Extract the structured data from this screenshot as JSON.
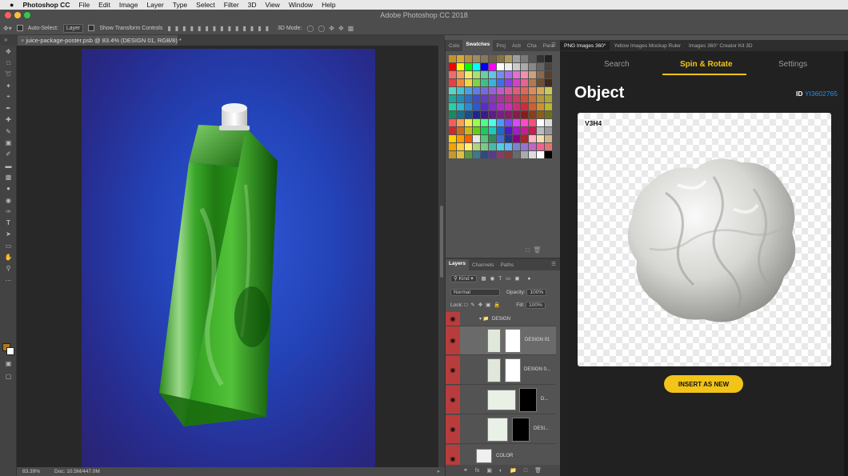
{
  "mac_menu": {
    "app_name": "Photoshop CC",
    "items": [
      "File",
      "Edit",
      "Image",
      "Layer",
      "Type",
      "Select",
      "Filter",
      "3D",
      "View",
      "Window",
      "Help"
    ]
  },
  "window": {
    "title": "Adobe Photoshop CC 2018"
  },
  "options_bar": {
    "auto_select_label": "Auto-Select:",
    "auto_select_value": "Layer",
    "show_transform_label": "Show Transform Controls",
    "mode_3d_label": "3D Mode:"
  },
  "document": {
    "tab_label": "juice-package-poster.psb @ 83.4% (DESIGN 01, RGB/8) *"
  },
  "status_bar": {
    "zoom": "83.39%",
    "doc_size": "Doc: 10.5M/447.0M"
  },
  "tools": {
    "fg_color": "#b07a12",
    "bg_color": "#ffffff"
  },
  "swatches_panel": {
    "tabs": [
      "Colo",
      "Swatches",
      "Proj",
      "Acti",
      "Cha",
      "Para"
    ],
    "active_tab": "Swatches",
    "swatches": [
      "#c8902a",
      "#d8a838",
      "#b88f3c",
      "#9a8d66",
      "#86775e",
      "#6b6049",
      "#8a7340",
      "#ad9a5a",
      "#9e9e9e",
      "#7a7a7a",
      "#555",
      "#333",
      "#222",
      "#ff0000",
      "#ffff00",
      "#00ff00",
      "#00ffff",
      "#0000ff",
      "#ff00ff",
      "#ffffff",
      "#eeeeee",
      "#cccccc",
      "#aaaaaa",
      "#888888",
      "#666666",
      "#444444",
      "#f26b6b",
      "#f5a25f",
      "#f8e66b",
      "#a9e26a",
      "#66d19e",
      "#5ec6e8",
      "#6d8ef2",
      "#a46df2",
      "#e46ddb",
      "#f28fb0",
      "#cf9f7a",
      "#8a6a4e",
      "#5a3f2a",
      "#e83f3f",
      "#ef8a3a",
      "#f0d63d",
      "#7fd34a",
      "#3fbf86",
      "#3ab1de",
      "#3f6fe8",
      "#8a3fe8",
      "#d83fc9",
      "#e8638f",
      "#b07a52",
      "#6e4e33",
      "#3f2a1a",
      "#5bd6c1",
      "#47c2d4",
      "#4aa1e0",
      "#5b7fe2",
      "#7a68e0",
      "#9c5fd9",
      "#c15ad0",
      "#d85aa7",
      "#e05b7e",
      "#e0675a",
      "#e08a5a",
      "#d6a95a",
      "#c9c95a",
      "#1fa89a",
      "#1f8fb5",
      "#2a6fc7",
      "#3f4fc9",
      "#5f3fc2",
      "#863bb5",
      "#a8359f",
      "#c23582",
      "#c93d5e",
      "#c9503a",
      "#c9733a",
      "#b8973a",
      "#a8a83a",
      "#2ad1a0",
      "#2ab8d1",
      "#2a8ad1",
      "#2a5ad1",
      "#5a2ad1",
      "#8a2ad1",
      "#b82ad1",
      "#d12ab8",
      "#d12a7a",
      "#d12a3a",
      "#d1602a",
      "#d1902a",
      "#b8b82a",
      "#1b8a5e",
      "#1b6f8a",
      "#1b4f8a",
      "#1b2a8a",
      "#3a1b8a",
      "#5e1b8a",
      "#7e1b8a",
      "#8a1b6f",
      "#8a1b4a",
      "#8a1b1b",
      "#8a3f1b",
      "#8a5e1b",
      "#6f6f1b",
      "#ff5a5a",
      "#ffa04a",
      "#ffe64a",
      "#9aff4a",
      "#4aff8a",
      "#4affe6",
      "#4a9aff",
      "#7a4aff",
      "#d64aff",
      "#ff4ac2",
      "#ff4a7a",
      "#ffffff",
      "#dddddd",
      "#cc2a2a",
      "#cc6a1a",
      "#ccb81a",
      "#6acc1a",
      "#1acc5a",
      "#1accb8",
      "#1a6acc",
      "#4a1acc",
      "#a41acc",
      "#cc1a92",
      "#cc1a4a",
      "#bbbbbb",
      "#999999",
      "#ffd200",
      "#ff9c00",
      "#ff5c00",
      "#e8e8e8",
      "#50c878",
      "#2e8b57",
      "#4169e1",
      "#1e3a8a",
      "#8b008b",
      "#b22222",
      "#ffb6c1",
      "#f5deb3",
      "#d2b48c",
      "#f4a300",
      "#ffcf40",
      "#fff176",
      "#aed581",
      "#81c784",
      "#4db6ac",
      "#4dd0e1",
      "#64b5f6",
      "#7986cb",
      "#9575cd",
      "#ba68c8",
      "#f06292",
      "#e57373",
      "#c49a2a",
      "#e0c040",
      "#5a9a3a",
      "#3a7a8a",
      "#2a4a8a",
      "#5a3a8a",
      "#8a3a6a",
      "#8a3a3a",
      "#6a6a6a",
      "#aaaaaa",
      "#dddddd",
      "#ffffff",
      "#000000"
    ]
  },
  "layers_panel": {
    "tabs": [
      "Layers",
      "Channels",
      "Paths"
    ],
    "active_tab": "Layers",
    "filter_kind": "Kind",
    "blend_mode": "Normal",
    "opacity_label": "Opacity:",
    "opacity_value": "100%",
    "lock_label": "Lock:",
    "fill_label": "Fill:",
    "fill_value": "100%",
    "group_name": "DESIGN",
    "layers": [
      {
        "name": "DESIGN 01"
      },
      {
        "name": "DESIGN 0..."
      },
      {
        "name": "D..."
      },
      {
        "name": "DESI..."
      },
      {
        "name": "COLOR"
      }
    ]
  },
  "plugin": {
    "tabs": [
      "PNG Images 360°",
      "Yellow Images Mockup Ruler",
      "Images 360° Creator Kit 3D"
    ],
    "nav": {
      "search": "Search",
      "spin_rotate": "Spin & Rotate",
      "settings": "Settings"
    },
    "title": "Object",
    "id_label": "ID",
    "id_value": "YI3602765",
    "view_label": "V3H4",
    "insert_label": "INSERT AS NEW",
    "accent": "#f2c318"
  }
}
